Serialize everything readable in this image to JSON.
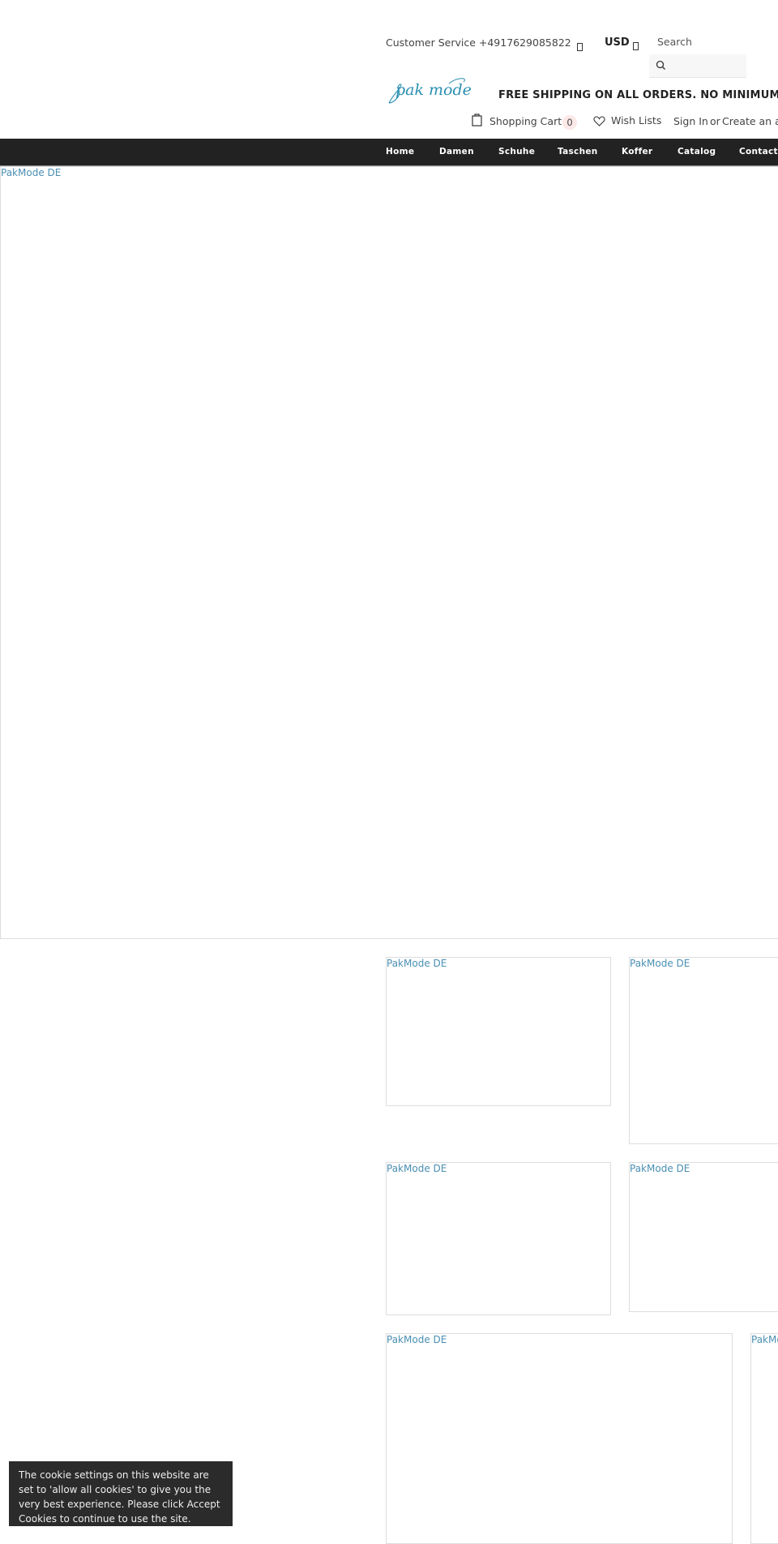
{
  "header": {
    "customer_service": "Customer Service +4917629085822",
    "currency": "USD",
    "search_label": "Search",
    "search_placeholder": "",
    "logo_text": "pak mode",
    "shipping_banner": "FREE SHIPPING ON ALL ORDERS. NO MINIMUM PURCHASE",
    "cart_label": "Shopping Cart",
    "cart_count": "0",
    "wishlist_label": "Wish Lists",
    "sign_in_label": "Sign In",
    "or_label": "or",
    "create_account_label": "Create an account"
  },
  "nav": {
    "items": [
      {
        "label": "Home"
      },
      {
        "label": "Damen"
      },
      {
        "label": "Schuhe"
      },
      {
        "label": "Taschen"
      },
      {
        "label": "Koffer"
      },
      {
        "label": "Catalog"
      },
      {
        "label": "Contact"
      }
    ]
  },
  "hero": {
    "alt": "PakMode DE"
  },
  "banners": [
    {
      "alt": "PakMode DE"
    },
    {
      "alt": "PakMode DE"
    },
    {
      "alt": "PakMode DE"
    },
    {
      "alt": "PakMode DE"
    },
    {
      "alt": "PakMode DE"
    },
    {
      "alt": "PakMode DE"
    }
  ],
  "cookie": {
    "text": "The cookie settings on this website are set to 'allow all cookies' to give you the very best experience. Please click Accept Cookies to continue to use the site."
  },
  "colors": {
    "nav_bg": "#222222",
    "link_alt": "#4a8fb3",
    "logo": "#2a8fb0",
    "cart_badge_bg": "#fde8e8",
    "cookie_bg": "#2b2b2b"
  }
}
